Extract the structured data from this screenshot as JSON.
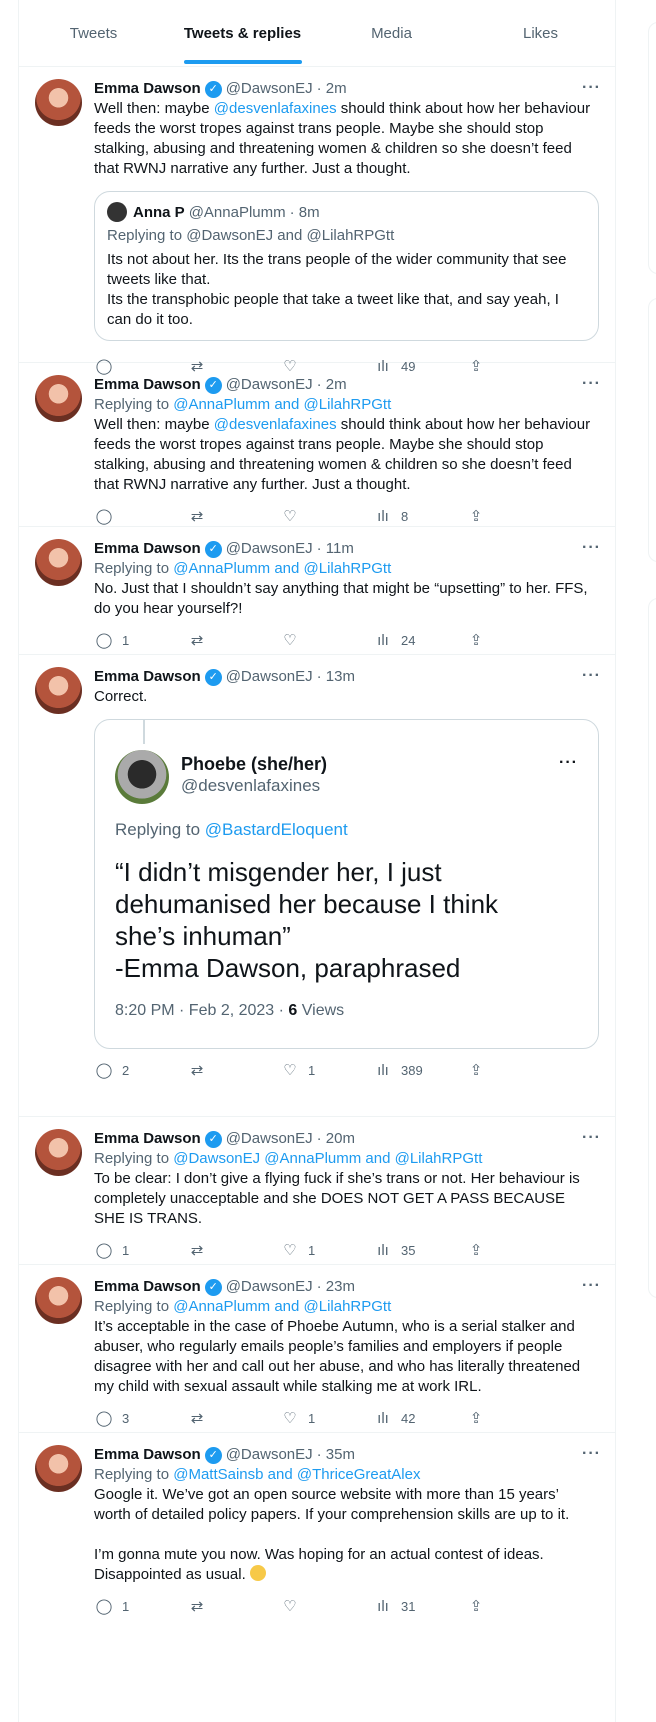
{
  "tabs": [
    {
      "label": "Tweets"
    },
    {
      "label": "Tweets & replies"
    },
    {
      "label": "Media"
    },
    {
      "label": "Likes"
    }
  ],
  "author": {
    "name": "Emma Dawson",
    "handle": "@DawsonEJ"
  },
  "tweets": [
    {
      "time": "· 2m",
      "text_parts": [
        "Well then: maybe ",
        "@desvenlafaxines",
        " should think about how her behaviour feeds the worst tropes against trans people. Maybe she should stop stalking, abusing and threatening women & children so she doesn’t feed that RWNJ narrative any further. Just a thought."
      ],
      "quote": {
        "name": "Anna P",
        "handle": "@AnnaPlumm",
        "time": "· 8m",
        "reply_to": "Replying to @DawsonEJ and @LilahRPGtt",
        "text": "Its not about her. Its the trans people of the wider community that see tweets like that.\nIts the transphobic people that take a tweet like that, and say yeah, I can do it too."
      },
      "replies": "",
      "retweets": "",
      "likes": "",
      "views": "49"
    },
    {
      "time": "· 2m",
      "reply_to": "@AnnaPlumm and @LilahRPGtt",
      "text_parts": [
        "Well then: maybe ",
        "@desvenlafaxines",
        " should think about how her behaviour feeds the worst tropes against trans people. Maybe she should stop stalking, abusing and threatening women & children so she doesn’t feed that RWNJ narrative any further. Just a thought."
      ],
      "replies": "",
      "retweets": "",
      "likes": "",
      "views": "8"
    },
    {
      "time": "· 11m",
      "reply_to": "@AnnaPlumm and @LilahRPGtt",
      "text": "No. Just that I shouldn’t say anything that might be “upsetting” to her. FFS, do you hear yourself?!",
      "replies": "1",
      "retweets": "",
      "likes": "",
      "views": "24"
    },
    {
      "time": "· 13m",
      "text": "Correct.",
      "card": {
        "name": "Phoebe (she/her)",
        "handle": "@desvenlafaxines",
        "reply_label": "Replying to ",
        "reply_to": "@BastardEloquent",
        "quote": "“I didn’t misgender her, I just dehumanised her because I think she’s inhuman”\n-Emma Dawson, paraphrased",
        "meta": "8:20 PM · Feb 2, 2023 · ",
        "views_count": "6",
        "views_label": " Views"
      },
      "replies": "2",
      "retweets": "",
      "likes": "1",
      "views": "389"
    },
    {
      "time": "· 20m",
      "reply_to": "@DawsonEJ @AnnaPlumm and @LilahRPGtt",
      "text": "To be clear: I don’t give a flying fuck if she’s trans or not. Her behaviour is completely unacceptable and she DOES NOT GET A PASS BECAUSE SHE IS TRANS.",
      "replies": "1",
      "retweets": "",
      "likes": "1",
      "views": "35"
    },
    {
      "time": "· 23m",
      "reply_to": "@AnnaPlumm and @LilahRPGtt",
      "text": "It’s acceptable in the case of Phoebe Autumn, who is a serial stalker and abuser, who regularly emails people’s families and employers if people disagree with her and call out her abuse, and who has literally threatened my child with sexual assault while stalking me at work IRL.",
      "replies": "3",
      "retweets": "",
      "likes": "1",
      "views": "42"
    },
    {
      "time": "· 35m",
      "reply_to": "@MattSainsb and @ThriceGreatAlex",
      "text": "Google it. We’ve got an open source website with more than 15 years’ worth of detailed policy papers. If your comprehension skills are up to it.\n\nI’m gonna mute you now. Was hoping for an actual contest of ideas. Disappointed as usual. ",
      "replies": "1",
      "retweets": "",
      "likes": "",
      "views": "31"
    }
  ],
  "labels": {
    "replying_to": "Replying to "
  },
  "icons": {
    "reply": "reply-icon",
    "retweet": "retweet-icon",
    "like": "heart-icon",
    "views": "views-icon",
    "share": "share-icon",
    "more": "more-icon",
    "verified": "verified-badge-icon",
    "emoji": "relieved-face-emoji-icon"
  },
  "colors": {
    "accent": "#1d9bf0",
    "text": "#0f1419",
    "muted": "#536471",
    "border": "#eff3f4"
  }
}
